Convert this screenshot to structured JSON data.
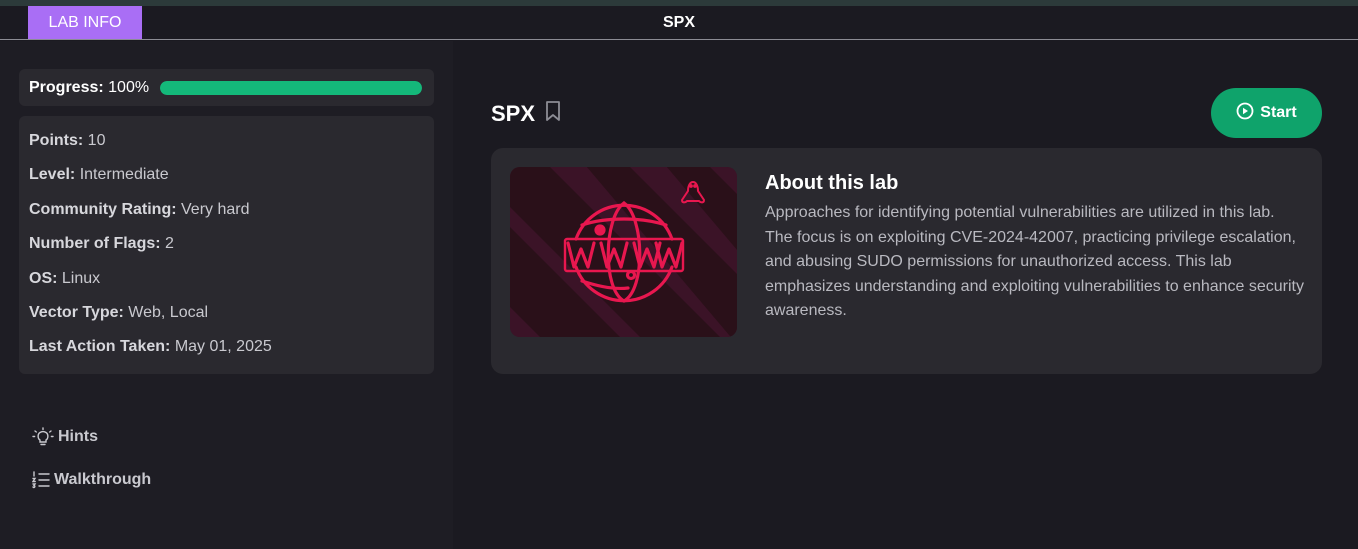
{
  "header": {
    "tab_label": "LAB INFO",
    "title": "SPX"
  },
  "sidebar": {
    "progress": {
      "label": "Progress:",
      "value_text": "100%",
      "value": 1.0
    },
    "info": [
      {
        "key": "Points:",
        "value": "10"
      },
      {
        "key": "Level:",
        "value": "Intermediate"
      },
      {
        "key": "Community Rating:",
        "value": "Very hard"
      },
      {
        "key": "Number of Flags:",
        "value": "2"
      },
      {
        "key": "OS:",
        "value": "Linux"
      },
      {
        "key": "Vector Type:",
        "value": "Web, Local"
      },
      {
        "key": "Last Action Taken:",
        "value": "May 01, 2025"
      }
    ],
    "links": [
      {
        "label": "Hints",
        "icon": "lightbulb-icon"
      },
      {
        "label": "Walkthrough",
        "icon": "numbered-list-icon"
      }
    ]
  },
  "main": {
    "lab_title": "SPX",
    "start_label": "Start",
    "about": {
      "title": "About this lab",
      "description": "Approaches for identifying potential vulnerabilities are utilized in this lab. The focus is on exploiting CVE-2024-42007, practicing privilege escalation, and abusing SUDO permissions for unauthorized access. This lab emphasizes understanding and exploiting vulnerabilities to enhance security awareness."
    },
    "image_icons": [
      "www-globe-icon",
      "linux-penguin-icon"
    ]
  },
  "colors": {
    "accent_purple": "#a96ef5",
    "progress_green": "#14b87a",
    "start_green": "#0fa36b",
    "image_pink": "#e8174f"
  }
}
